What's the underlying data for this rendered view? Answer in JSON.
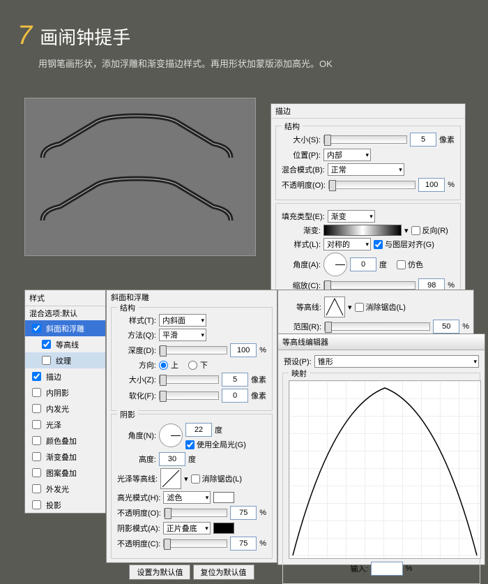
{
  "header": {
    "num": "7",
    "title": "画闹钟提手",
    "desc": "用钢笔画形状，添加浮雕和渐变描边样式。再用形状加蒙版添加高光。OK"
  },
  "stroke": {
    "title": "描边",
    "struct": "结构",
    "size_lbl": "大小(S):",
    "size": "5",
    "size_unit": "像素",
    "pos_lbl": "位置(P):",
    "pos": "内部",
    "blend_lbl": "混合模式(B):",
    "blend": "正常",
    "opac_lbl": "不透明度(O):",
    "opac": "100",
    "pct": "%",
    "fill_lbl": "填充类型(E):",
    "fill": "渐变",
    "grad_lbl": "渐变:",
    "reverse": "反向(R)",
    "style_lbl": "样式(L):",
    "style": "对称的",
    "align": "与图层对齐(G)",
    "angle_lbl": "角度(A):",
    "angle": "0",
    "deg": "度",
    "dither": "仿色",
    "scale_lbl": "缩放(C):",
    "scale": "98"
  },
  "styles": {
    "hd": "样式",
    "blend_opt": "混合选项:默认",
    "bevel": "斜面和浮雕",
    "contour": "等高线",
    "texture": "纹理",
    "stroke": "描边",
    "inner_shadow": "内阴影",
    "inner_glow": "内发光",
    "satin": "光泽",
    "color_ov": "颜色叠加",
    "grad_ov": "渐变叠加",
    "pat_ov": "图案叠加",
    "outer_glow": "外发光",
    "drop": "投影"
  },
  "bevel": {
    "title": "斜面和浮雕",
    "struct": "结构",
    "style_lbl": "样式(T):",
    "style": "内斜面",
    "tech_lbl": "方法(Q):",
    "tech": "平滑",
    "depth_lbl": "深度(D):",
    "depth": "100",
    "pct": "%",
    "dir_lbl": "方向:",
    "up": "上",
    "down": "下",
    "size_lbl": "大小(Z):",
    "size": "5",
    "px": "像素",
    "soft_lbl": "软化(F):",
    "soft": "0",
    "shade": "阴影",
    "angle_lbl": "角度(N):",
    "angle": "22",
    "deg": "度",
    "global": "使用全局光(G)",
    "alt_lbl": "高度:",
    "alt": "30",
    "gloss_lbl": "光泽等高线:",
    "anti": "消除锯齿(L)",
    "hi_lbl": "高光模式(H):",
    "hi": "滤色",
    "hi_opac_lbl": "不透明度(O):",
    "hi_opac": "75",
    "sh_lbl": "阴影模式(A):",
    "sh": "正片叠底",
    "sh_opac_lbl": "不透明度(C):",
    "sh_opac": "75",
    "default": "设置为默认值",
    "reset": "复位为默认值"
  },
  "contour": {
    "lbl": "等高线:",
    "anti": "消除锯齿(L)",
    "range_lbl": "范围(R):",
    "range": "50",
    "pct": "%",
    "editor": "等高线编辑器",
    "preset_lbl": "预设(P):",
    "preset": "锥形",
    "map": "映射",
    "input_lbl": "输入:",
    "input_pct": "%"
  }
}
